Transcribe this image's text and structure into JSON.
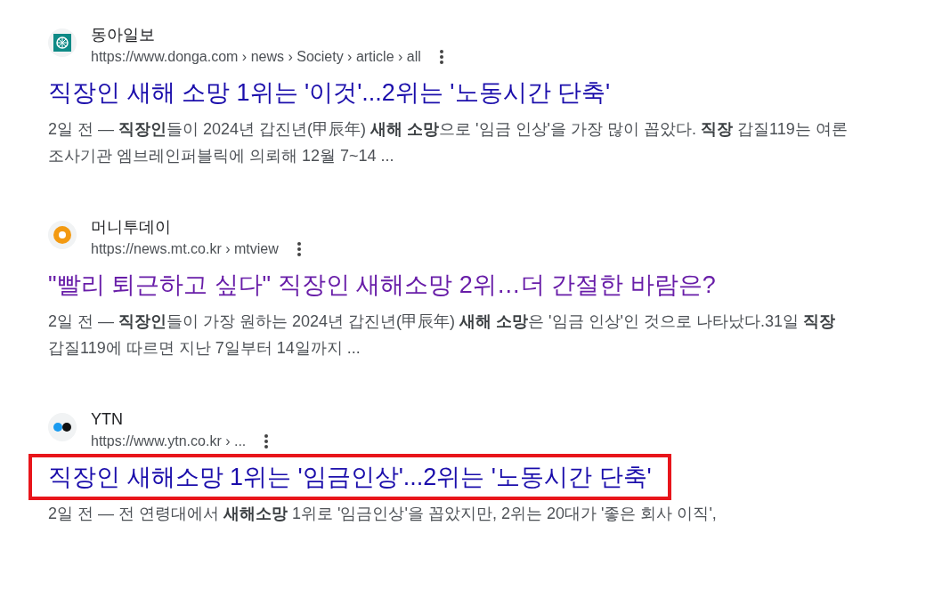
{
  "results": [
    {
      "site": "동아일보",
      "url": "https://www.donga.com › news › Society › article › all",
      "kind": "donga",
      "title": "직장인 새해 소망 1위는 '이것'...2위는 '노동시간 단축'",
      "visited": false,
      "highlighted": false,
      "snippet": "2일 전 — **직장인**들이 2024년 갑진년(甲辰年) **새해 소망**으로 '임금 인상'을 가장 많이 꼽았다. **직장** 갑질119는 여론조사기관 엠브레인퍼블릭에 의뢰해 12월 7~14 ..."
    },
    {
      "site": "머니투데이",
      "url": "https://news.mt.co.kr › mtview",
      "kind": "mt",
      "title": "\"빨리 퇴근하고 싶다\" 직장인 새해소망 2위…더 간절한 바람은?",
      "visited": true,
      "highlighted": false,
      "snippet": "2일 전 — **직장인**들이 가장 원하는 2024년 갑진년(甲辰年) **새해 소망**은 '임금 인상'인 것으로 나타났다.31일 **직장**갑질119에 따르면 지난 7일부터 14일까지 ..."
    },
    {
      "site": "YTN",
      "url": "https://www.ytn.co.kr › ...",
      "kind": "ytn",
      "title": "직장인 새해소망 1위는 '임금인상'...2위는 '노동시간 단축'",
      "visited": false,
      "highlighted": true,
      "snippet": "2일 전 — 전 연령대에서 **새해소망** 1위로 '임금인상'을 꼽았지만, 2위는 20대가 '좋은 회사 이직',"
    }
  ]
}
